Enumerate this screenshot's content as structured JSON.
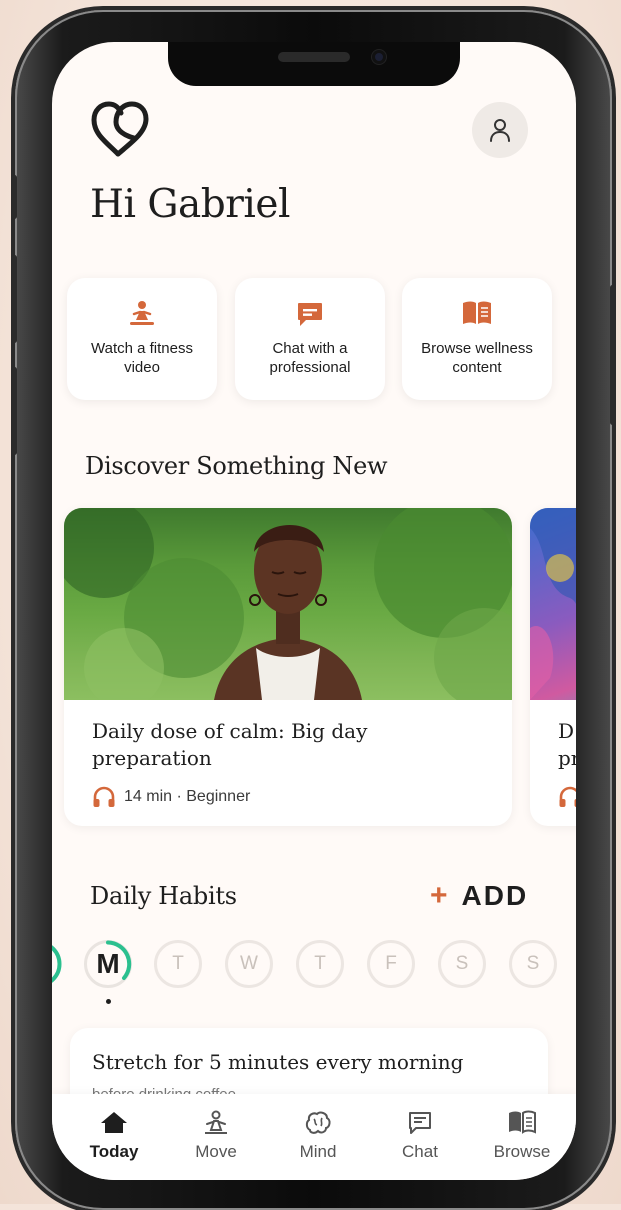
{
  "greeting": "Hi Gabriel",
  "quick_actions": [
    {
      "label": "Watch a fitness video",
      "icon": "fitness-icon"
    },
    {
      "label": "Chat with a professional",
      "icon": "chat-icon"
    },
    {
      "label": "Browse wellness content",
      "icon": "book-icon"
    }
  ],
  "discover": {
    "title": "Discover Something New",
    "cards": [
      {
        "title": "Daily dose of calm: Big day preparation",
        "meta": "14 min · Beginner",
        "icon": "headphones-icon"
      },
      {
        "title": "D pr",
        "meta": "",
        "icon": "headphones-icon"
      }
    ]
  },
  "habits": {
    "title": "Daily Habits",
    "add_plus": "+",
    "add_label": "ADD",
    "days": [
      "M",
      "T",
      "W",
      "T",
      "F",
      "S",
      "S"
    ],
    "selected_day": "M",
    "card_title": "Stretch for 5 minutes every morning",
    "card_subtitle": "before drinking coffee"
  },
  "tabs": [
    {
      "label": "Today",
      "icon": "home-icon",
      "active": true
    },
    {
      "label": "Move",
      "icon": "meditation-icon",
      "active": false
    },
    {
      "label": "Mind",
      "icon": "brain-icon",
      "active": false
    },
    {
      "label": "Chat",
      "icon": "chat-icon",
      "active": false
    },
    {
      "label": "Browse",
      "icon": "book-icon",
      "active": false
    }
  ],
  "colors": {
    "accent": "#d4683b",
    "progress_green": "#2bc08f",
    "text": "#1e1e1e",
    "screen_bg": "#fffaf7"
  }
}
